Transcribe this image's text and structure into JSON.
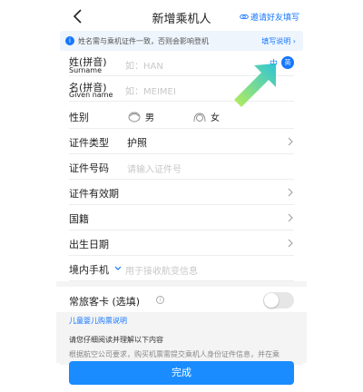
{
  "header": {
    "title": "新增乘机人",
    "invite_label": "邀请好友填写"
  },
  "notice": {
    "text": "姓名需与乘机证件一致，否则会影响登机",
    "link_label": "填写说明"
  },
  "form": {
    "surname": {
      "label": "姓(拼音)",
      "sublabel": "Surname",
      "placeholder": "如：HAN"
    },
    "given_name": {
      "label": "名(拼音)",
      "sublabel": "Given name",
      "placeholder": "如：MEIMEI"
    },
    "lang_toggle": {
      "cn": "中",
      "en": "英"
    },
    "gender": {
      "label": "性别",
      "male": "男",
      "female": "女"
    },
    "id_type": {
      "label": "证件类型",
      "value": "护照"
    },
    "id_number": {
      "label": "证件号码",
      "placeholder": "请输入证件号"
    },
    "id_expiry": {
      "label": "证件有效期"
    },
    "nationality": {
      "label": "国籍"
    },
    "birthdate": {
      "label": "出生日期"
    },
    "phone": {
      "label": "境内手机",
      "placeholder": "用于接收航变信息"
    },
    "frequent_flyer": {
      "label": "常旅客卡 (选填)",
      "enabled": false
    }
  },
  "child_link": "儿童婴儿购票说明",
  "read_notice": {
    "title": "请您仔细阅读并理解以下内容",
    "body": "根据航空公司要求，购买机票需提交乘机人身份证件信息，并在乘"
  },
  "submit_label": "完成",
  "colors": {
    "accent": "#1677ff",
    "button": "#1a8cff",
    "arrow": "#2ec4d6"
  }
}
